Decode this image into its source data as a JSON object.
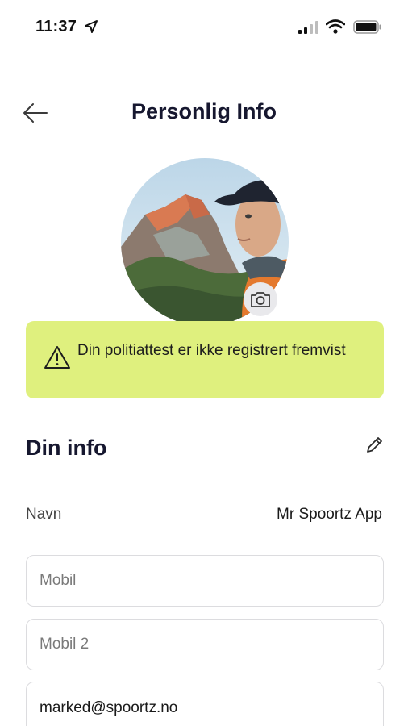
{
  "status_bar": {
    "time": "11:37",
    "icons": [
      "location-arrow-icon",
      "signal-icon",
      "wifi-icon",
      "battery-icon"
    ]
  },
  "header": {
    "title": "Personlig Info",
    "back_icon": "arrow-left-icon"
  },
  "avatar": {
    "description_icon": "profile-photo",
    "camera_icon": "camera-icon"
  },
  "alert": {
    "text": "Din politiattest er ikke registrert fremvist",
    "icon": "warning-triangle-icon",
    "background": "#dff07e"
  },
  "section": {
    "title": "Din info",
    "edit_icon": "pencil-icon"
  },
  "info": {
    "name_label": "Navn",
    "name_value": "Mr Spoortz App"
  },
  "fields": {
    "mobil_placeholder": "Mobil",
    "mobil2_placeholder": "Mobil 2",
    "email_value": "marked@spoortz.no"
  },
  "colors": {
    "title": "#16172f",
    "alert_bg": "#dff07e",
    "field_border": "#dcdcdf"
  }
}
